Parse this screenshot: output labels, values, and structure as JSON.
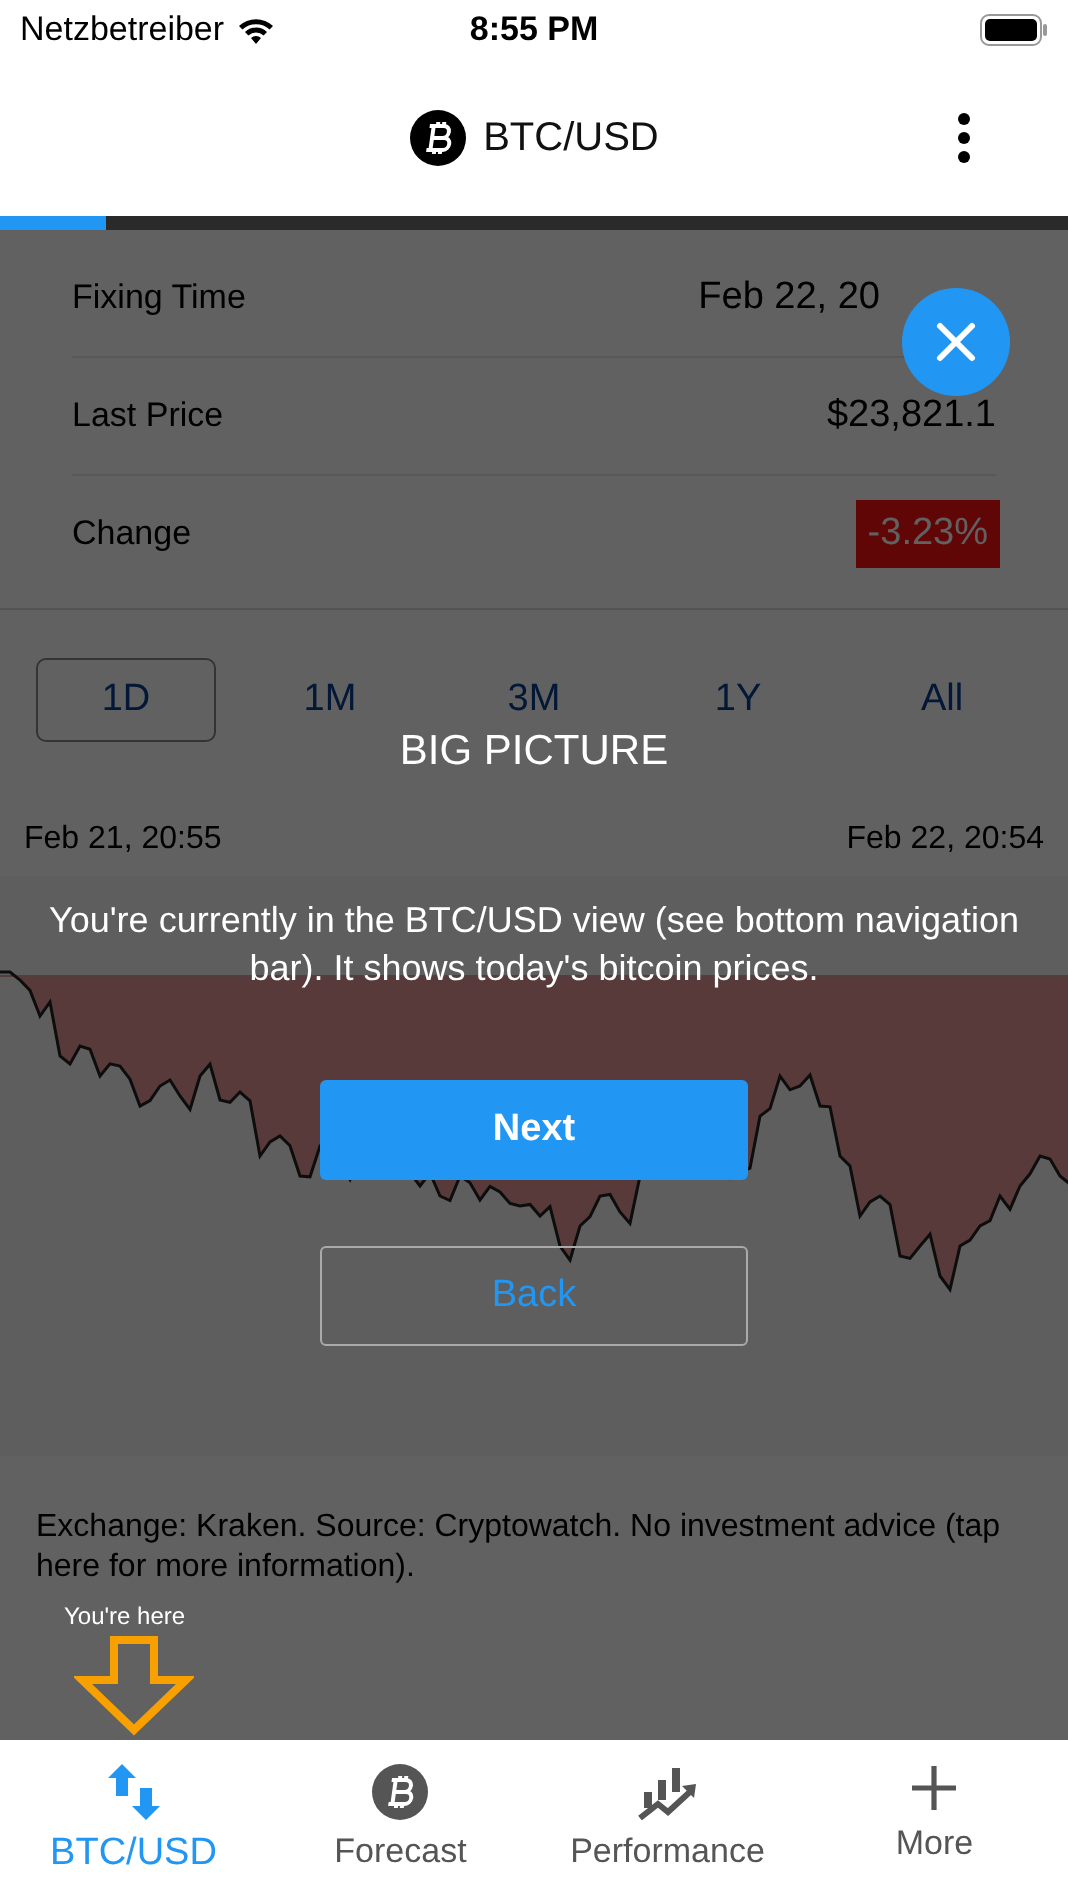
{
  "status_bar": {
    "carrier": "Netzbetreiber",
    "time": "8:55 PM"
  },
  "header": {
    "title": "BTC/USD"
  },
  "quote": {
    "rows": [
      {
        "label": "Fixing Time",
        "value": "Feb 22, 20",
        "kind": "plain"
      },
      {
        "label": "Last Price",
        "value": "$23,821.1",
        "kind": "plain"
      },
      {
        "label": "Change",
        "value": "-3.23%",
        "kind": "badge"
      }
    ]
  },
  "ranges": [
    {
      "label": "1D",
      "selected": true
    },
    {
      "label": "1M",
      "selected": false
    },
    {
      "label": "3M",
      "selected": false
    },
    {
      "label": "1Y",
      "selected": false
    },
    {
      "label": "All",
      "selected": false
    }
  ],
  "chart": {
    "start_label": "Feb 21, 20:55",
    "end_label": "Feb 22, 20:54"
  },
  "disclaimer": "Exchange: Kraken. Source: Cryptowatch. No investment advice (tap here for more information).",
  "tour": {
    "progress": {
      "level": 0.1
    },
    "title": "BIG PICTURE",
    "text": "You're currently in the BTC/USD view (see bottom navigation bar). It shows today's bitcoin prices.",
    "next": "Next",
    "back": "Back",
    "hint": "You're here"
  },
  "bottom_nav": [
    {
      "label": "BTC/USD",
      "selected": true
    },
    {
      "label": "Forecast",
      "selected": false
    },
    {
      "label": "Performance",
      "selected": false
    },
    {
      "label": "More",
      "selected": false
    }
  ]
}
